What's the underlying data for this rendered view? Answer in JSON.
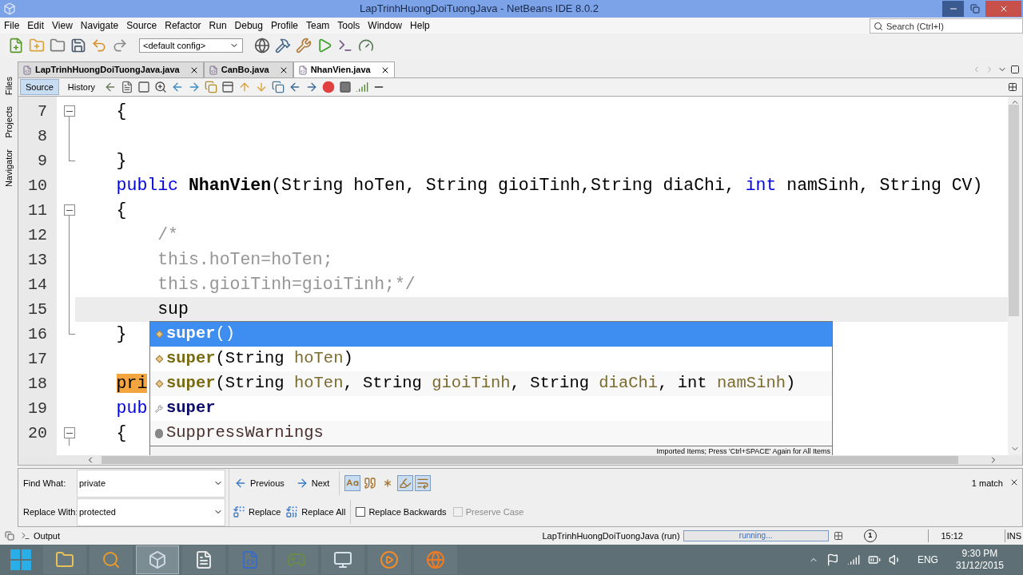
{
  "window": {
    "title": "LapTrinhHuongDoiTuongJava - NetBeans IDE 8.0.2"
  },
  "menu": [
    "File",
    "Edit",
    "View",
    "Navigate",
    "Source",
    "Refactor",
    "Run",
    "Debug",
    "Profile",
    "Team",
    "Tools",
    "Window",
    "Help"
  ],
  "toolbar": {
    "config": "<default config>",
    "search_placeholder": "Search (Ctrl+I)"
  },
  "side_tabs": [
    "Files",
    "Projects",
    "Navigator"
  ],
  "editor_tabs": [
    {
      "label": "LapTrinhHuongDoiTuongJava.java",
      "selected": false
    },
    {
      "label": "CanBo.java",
      "selected": false
    },
    {
      "label": "NhanVien.java",
      "selected": true
    }
  ],
  "view_modes": [
    {
      "label": "Source",
      "selected": true
    },
    {
      "label": "History",
      "selected": false
    }
  ],
  "code_lines": [
    {
      "number": "7",
      "kind": "fold-start",
      "current": false,
      "tokens": [
        {
          "text": "    {",
          "kind": "plain"
        }
      ]
    },
    {
      "number": "8",
      "kind": "fold-inside"
    },
    {
      "number": "9",
      "kind": "fold-end",
      "current": false,
      "tokens": [
        {
          "text": "    }",
          "kind": "plain"
        }
      ]
    },
    {
      "number": "10",
      "kind": "plain",
      "current": false,
      "tokens": [
        {
          "text": "    public",
          "kind": "keyword"
        },
        {
          "text": " NhanVien",
          "kind": "bold"
        },
        {
          "text": "(String hoTen, String gioiTinh,String diaChi, ",
          "kind": "plain"
        },
        {
          "text": "int",
          "kind": "keyword"
        },
        {
          "text": " namSinh, String CV)",
          "kind": "plain"
        }
      ]
    },
    {
      "number": "11",
      "kind": "fold-start",
      "current": false,
      "tokens": [
        {
          "text": "    {",
          "kind": "plain"
        }
      ]
    },
    {
      "number": "12",
      "kind": "fold-inside",
      "current": false,
      "tokens": [
        {
          "text": "        /*",
          "kind": "comment"
        }
      ]
    },
    {
      "number": "13",
      "kind": "fold-inside",
      "current": false,
      "tokens": [
        {
          "text": "        this.hoTen=hoTen;",
          "kind": "comment"
        }
      ]
    },
    {
      "number": "14",
      "kind": "fold-inside",
      "current": false,
      "tokens": [
        {
          "text": "        this.gioiTinh=gioiTinh;*/",
          "kind": "comment"
        }
      ]
    },
    {
      "number": "15",
      "kind": "fold-inside",
      "current": true,
      "tokens": [
        {
          "text": "        sup",
          "kind": "plain"
        }
      ]
    },
    {
      "number": "16",
      "kind": "fold-end",
      "current": false,
      "tokens": [
        {
          "text": "    }",
          "kind": "plain"
        }
      ]
    },
    {
      "number": "17",
      "kind": "plain"
    },
    {
      "number": "18",
      "kind": "plain",
      "current": false,
      "tokens": [
        {
          "text": "    pri",
          "kind": "match"
        }
      ]
    },
    {
      "number": "19",
      "kind": "plain",
      "current": false,
      "tokens": [
        {
          "text": "    pub",
          "kind": "keyword"
        }
      ]
    },
    {
      "number": "20",
      "kind": "fold-start",
      "current": false,
      "tokens": [
        {
          "text": "    {",
          "kind": "plain"
        }
      ]
    }
  ],
  "completion": {
    "items": [
      {
        "kind": "method",
        "selected": true,
        "parts": [
          {
            "text": "super",
            "kind": "name"
          },
          {
            "text": "()",
            "kind": "punct"
          }
        ]
      },
      {
        "kind": "method",
        "selected": false,
        "parts": [
          {
            "text": "super",
            "kind": "name"
          },
          {
            "text": "(String ",
            "kind": "punct"
          },
          {
            "text": "hoTen",
            "kind": "param"
          },
          {
            "text": ")",
            "kind": "punct"
          }
        ]
      },
      {
        "kind": "method",
        "selected": false,
        "parts": [
          {
            "text": "super",
            "kind": "name"
          },
          {
            "text": "(String ",
            "kind": "punct"
          },
          {
            "text": "hoTen",
            "kind": "param"
          },
          {
            "text": ", String ",
            "kind": "punct"
          },
          {
            "text": "gioiTinh",
            "kind": "param"
          },
          {
            "text": ", String ",
            "kind": "punct"
          },
          {
            "text": "diaChi",
            "kind": "param"
          },
          {
            "text": ", int ",
            "kind": "punct"
          },
          {
            "text": "namSinh",
            "kind": "param"
          },
          {
            "text": ")",
            "kind": "punct"
          }
        ]
      },
      {
        "kind": "keyword",
        "selected": false,
        "parts": [
          {
            "text": "super",
            "kind": "keyword"
          }
        ]
      },
      {
        "kind": "annotation",
        "selected": false,
        "parts": [
          {
            "text": "SuppressWarnings",
            "kind": "annotation"
          }
        ]
      }
    ],
    "footer": "Imported Items; Press 'Ctrl+SPACE' Again for All Items"
  },
  "find_bar": {
    "find_label": "Find What:",
    "find_value": "private",
    "replace_label": "Replace With:",
    "replace_value": "protected",
    "previous": "Previous",
    "next": "Next",
    "replace": "Replace",
    "replace_all": "Replace All",
    "toggles": [
      {
        "kind": "case",
        "selected": true
      },
      {
        "kind": "quotes",
        "selected": false
      },
      {
        "kind": "regex",
        "selected": false
      },
      {
        "kind": "highlight",
        "selected": true
      },
      {
        "kind": "wrap",
        "selected": true
      }
    ],
    "checkboxes": [
      {
        "label": "Replace Backwards",
        "checked": false,
        "disabled": false
      },
      {
        "label": "Preserve Case",
        "checked": false,
        "disabled": true
      }
    ],
    "matches": "1 match"
  },
  "status_bar": {
    "output_tab": "Output",
    "task": "LapTrinhHuongDoiTuongJava (run)",
    "progress": "running...",
    "notifications": "1",
    "position": "15:12",
    "mode": "INS"
  },
  "taskbar": {
    "apps": [
      {
        "kind": "folder",
        "selected": false
      },
      {
        "kind": "search",
        "selected": false
      },
      {
        "kind": "cube",
        "selected": true
      },
      {
        "kind": "notepad",
        "selected": false
      },
      {
        "kind": "document",
        "selected": false
      },
      {
        "kind": "game",
        "selected": false
      },
      {
        "kind": "monitor",
        "selected": false
      },
      {
        "kind": "player",
        "selected": false
      },
      {
        "kind": "browser",
        "selected": false
      }
    ],
    "language": "ENG",
    "time": "9:30 PM",
    "date": "31/12/2015"
  }
}
